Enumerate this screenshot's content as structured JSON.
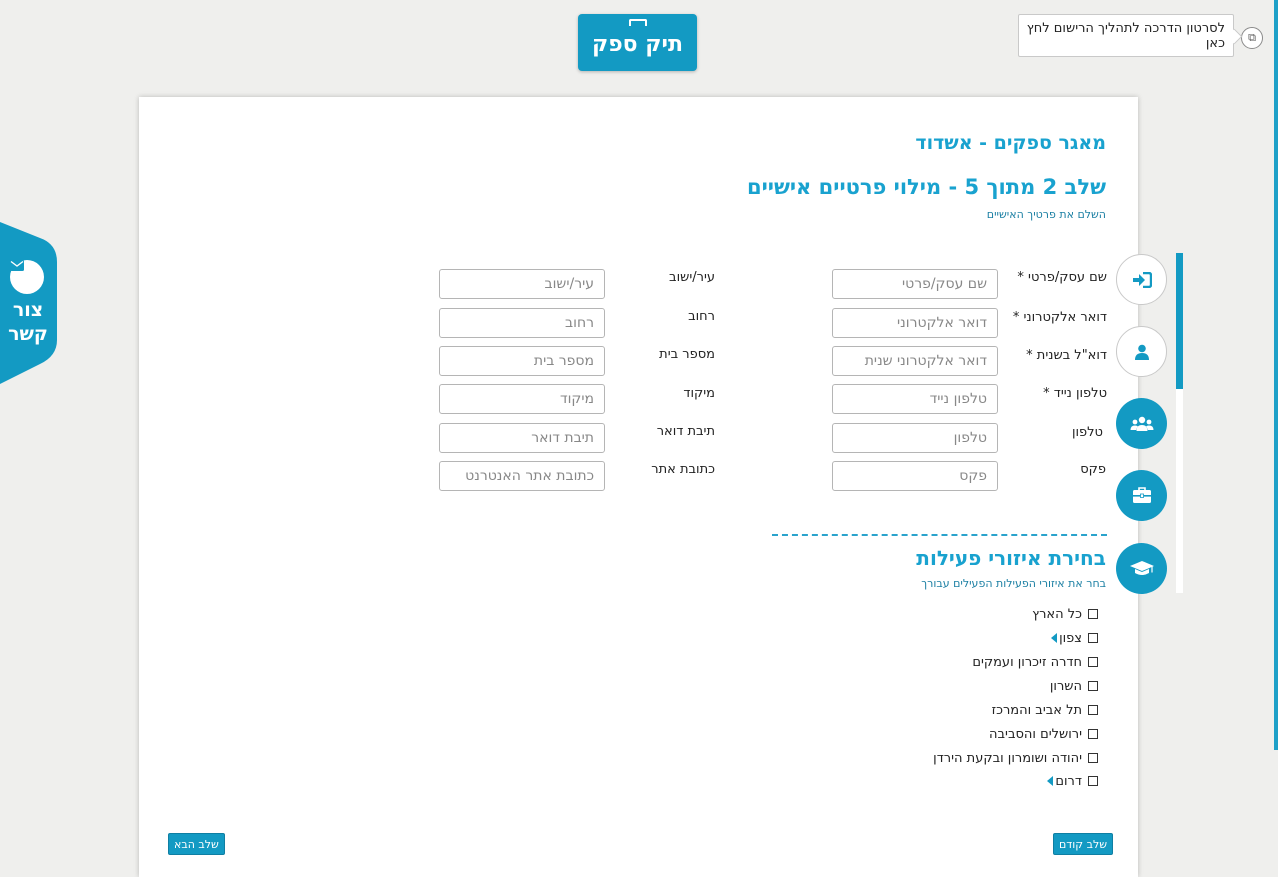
{
  "header": {
    "tutorial_text": "לסרטון הדרכה לתהליך הרישום לחץ כאן",
    "logo_text": "תיק ספק"
  },
  "contact": {
    "label_line1": "צור",
    "label_line2": "קשר"
  },
  "page": {
    "db_title": "מאגר ספקים - אשדוד",
    "step_title": "שלב 2 מתוך 5 - מילוי פרטיים אישיים",
    "step_subtitle": "השלם את פרטיך האישיים"
  },
  "form": {
    "right": [
      {
        "label": "שם עסק/פרטי *",
        "placeholder": "שם עסק/פרטי"
      },
      {
        "label": "דואר אלקטרוני *",
        "placeholder": "דואר אלקטרוני"
      },
      {
        "label": "דוא\"ל בשנית *",
        "placeholder": "דואר אלקטרוני שנית"
      },
      {
        "label": "טלפון נייד *",
        "placeholder": "טלפון נייד"
      },
      {
        "label": "טלפון",
        "placeholder": "טלפון"
      },
      {
        "label": "פקס",
        "placeholder": "פקס"
      }
    ],
    "left": [
      {
        "label": "עיר/ישוב",
        "placeholder": "עיר/ישוב"
      },
      {
        "label": "רחוב",
        "placeholder": "רחוב"
      },
      {
        "label": "מספר בית",
        "placeholder": "מספר בית"
      },
      {
        "label": "מיקוד",
        "placeholder": "מיקוד"
      },
      {
        "label": "תיבת דואר",
        "placeholder": "תיבת דואר"
      },
      {
        "label": "כתובת אתר",
        "placeholder": "כתובת אתר האנטרנט"
      }
    ]
  },
  "areas": {
    "title": "בחירת איזורי פעילות",
    "subtitle": "בחר את איזורי הפעילות הפעילים עבורך",
    "items": [
      {
        "label": "כל הארץ",
        "expandable": false
      },
      {
        "label": "צפון",
        "expandable": true
      },
      {
        "label": "חדרה זיכרון ועמקים",
        "expandable": false
      },
      {
        "label": "השרון",
        "expandable": false
      },
      {
        "label": "תל אביב והמרכז",
        "expandable": false
      },
      {
        "label": "ירושלים והסביבה",
        "expandable": false
      },
      {
        "label": "יהודה ושומרון ובקעת הירדן",
        "expandable": false
      },
      {
        "label": "דרום",
        "expandable": true
      }
    ]
  },
  "buttons": {
    "prev": "שלב קודם",
    "next": "שלב הבא"
  },
  "nav_icons": [
    "sign-in-icon",
    "user-icon",
    "users-icon",
    "briefcase-icon",
    "graduation-cap-icon"
  ],
  "colors": {
    "accent": "#139ac3",
    "title": "#19a2cf",
    "background": "#efefed"
  }
}
